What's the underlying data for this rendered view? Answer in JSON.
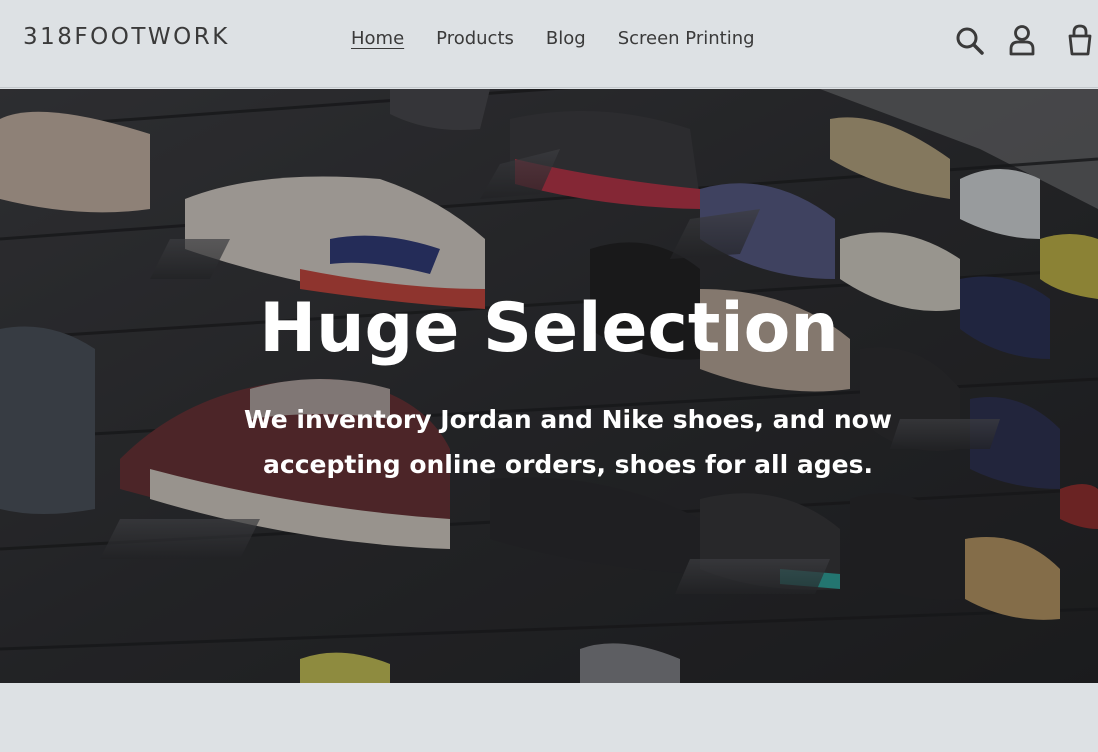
{
  "header": {
    "logo": "318FOOTWORK",
    "nav": [
      {
        "label": "Home",
        "active": true
      },
      {
        "label": "Products",
        "active": false
      },
      {
        "label": "Blog",
        "active": false
      },
      {
        "label": "Screen Printing",
        "active": false
      }
    ],
    "icons": [
      "search-icon",
      "account-icon",
      "cart-icon"
    ]
  },
  "hero": {
    "title": "Huge Selection",
    "subtitle": "We inventory Jordan and Nike shoes, and now accepting online orders, shoes for all ages."
  },
  "colors": {
    "background": "#dde1e4",
    "text": "#3a3a3a",
    "hero_text": "#ffffff"
  }
}
